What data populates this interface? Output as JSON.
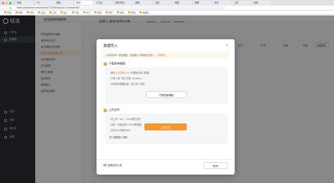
{
  "browser": {
    "tabs": [
      "新浪",
      "TG",
      "搜索",
      "轻流",
      "工作台",
      "新标签页",
      "教程",
      "文档",
      "帮助",
      "收藏",
      "资讯",
      "工具",
      "设置"
    ],
    "url": "https://qingflow.com/index/f722298/app/2c1ca0ee/edit?",
    "bookmarks": [
      "百度",
      "淘宝",
      "轻流",
      "文档",
      "工具",
      "设计",
      "开发",
      "学习",
      "视频",
      "音乐",
      "阅读",
      "其他",
      "收藏夹"
    ]
  },
  "navrail": {
    "logo": "轻流",
    "items": [
      {
        "label": "工作台",
        "icon": "home-icon"
      },
      {
        "label": "应用包",
        "icon": "apps-icon"
      },
      {
        "label": "动态",
        "icon": "bell-icon"
      },
      {
        "label": "消息",
        "icon": "message-icon"
      },
      {
        "label": "通讯录",
        "icon": "contacts-icon"
      },
      {
        "label": "设置",
        "icon": "gear-icon"
      }
    ]
  },
  "app": {
    "breadcrumb": "校园疫情防御管理",
    "form_title": "返校入学信息登记表",
    "toolbar_tabs": [
      "编辑表单",
      "流程设置",
      "数据管理"
    ],
    "tree": [
      "学校疫情防控管理",
      "疫情信息总览",
      "每日健康信息申报",
      "返校入学信息登记表",
      "每日健康排查",
      "学生管理",
      "教职工管理",
      "返校审核",
      "数据统计",
      "疫情信息通知"
    ],
    "columns": [
      "姓名",
      "学号",
      "班级",
      "年级"
    ],
    "header_button": "数据操作"
  },
  "modal": {
    "title": "数据导入",
    "notice": "1.仅填写单个字段数据，请按照以下规则进行导入，",
    "notice_link": "了解更多",
    "step1": {
      "number": "1",
      "title": "下载表单模版",
      "lines": [
        "· 使用 标准模板.xlsx 在模版中填入数据。",
        "· 只导入第一张工作表（sheet1）",
        "· 请勿修改表格标题，防止导入失败。"
      ],
      "link_text": "标准模板.xlsx",
      "button": "下载表单模板"
    },
    "step2": {
      "number": "2",
      "title": "上传文件",
      "lines": [
        "· 请上传 *.xls，*.xlsx格式文件",
        "· 目前一次最多导入5000条数据。",
        "· 文件大小不超过5M。"
      ],
      "import_label": "导入数据进入流程",
      "button": "上传文件"
    },
    "log_label": "查看操作记录",
    "cancel": "取消"
  }
}
